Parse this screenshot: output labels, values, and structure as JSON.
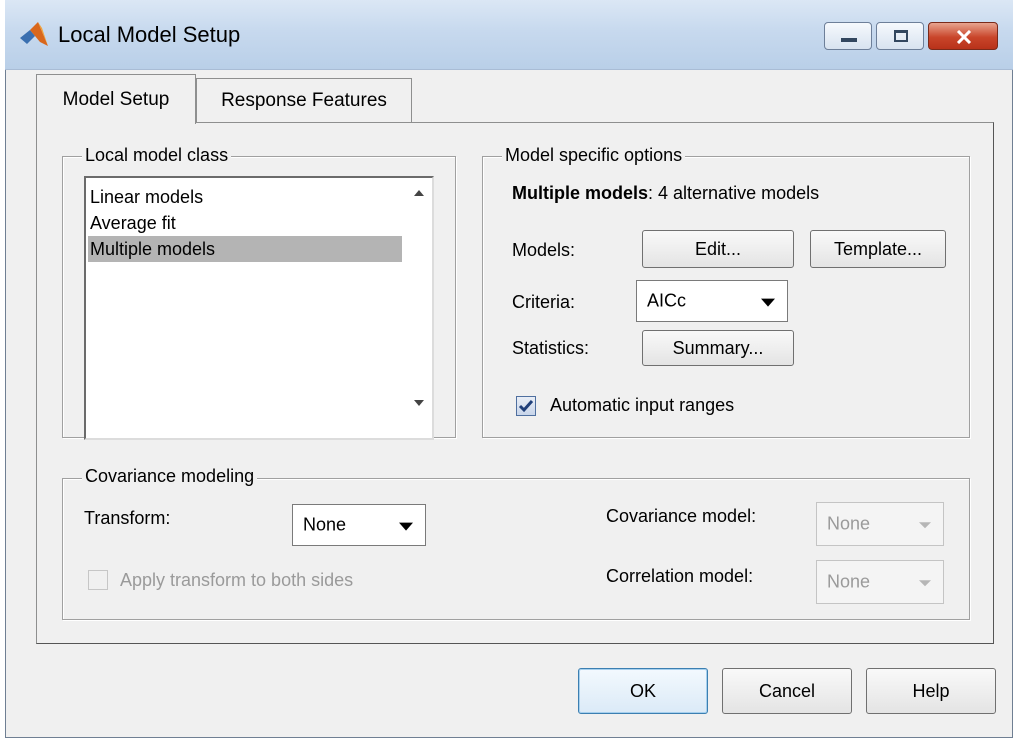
{
  "window": {
    "title": "Local Model Setup"
  },
  "tabs": [
    {
      "label": "Model Setup",
      "active": true
    },
    {
      "label": "Response Features",
      "active": false
    }
  ],
  "local_model_class": {
    "label": "Local model class",
    "items": [
      "Linear models",
      "Average fit",
      "Multiple models"
    ],
    "selected": "Multiple models"
  },
  "model_options": {
    "label": "Model specific options",
    "heading_bold": "Multiple models",
    "heading_rest": ": 4 alternative models",
    "models_label": "Models:",
    "edit_button": "Edit...",
    "template_button": "Template...",
    "criteria_label": "Criteria:",
    "criteria_value": "AICc",
    "statistics_label": "Statistics:",
    "summary_button": "Summary...",
    "auto_ranges_label": "Automatic input ranges",
    "auto_ranges_checked": true
  },
  "covariance": {
    "label": "Covariance modeling",
    "transform_label": "Transform:",
    "transform_value": "None",
    "apply_transform_label": "Apply transform to both sides",
    "apply_transform_checked": false,
    "cov_model_label": "Covariance model:",
    "cov_model_value": "None",
    "corr_model_label": "Correlation model:",
    "corr_model_value": "None"
  },
  "footer": {
    "ok": "OK",
    "cancel": "Cancel",
    "help": "Help"
  },
  "colors": {
    "selection": "#b4b4b4",
    "title_bar": "#c7d9ee",
    "close_button": "#c9452a"
  }
}
